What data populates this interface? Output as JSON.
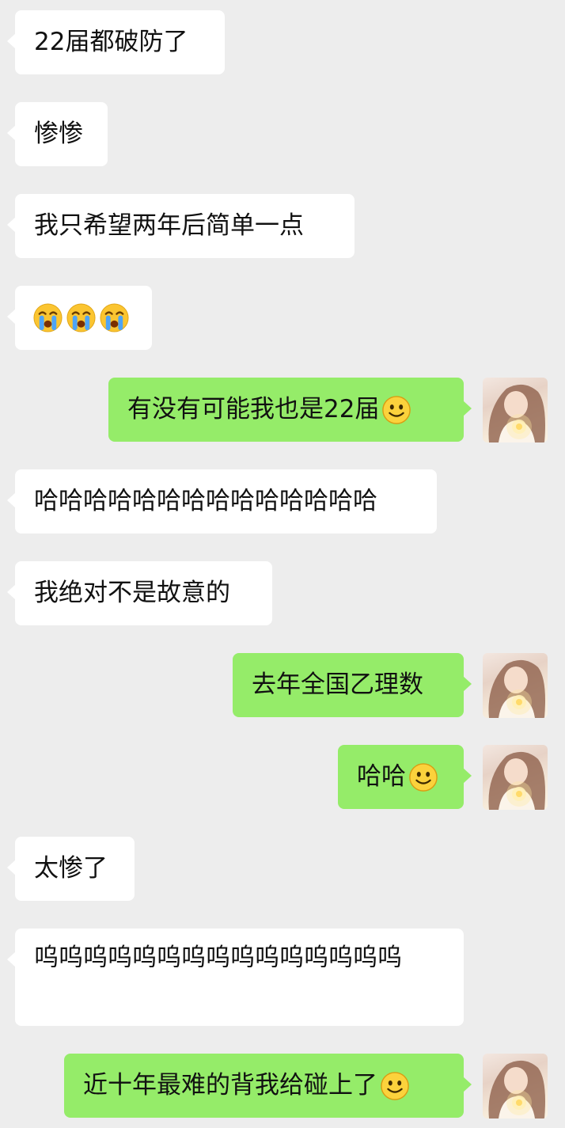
{
  "messages": [
    {
      "side": "left",
      "text": "22届都破防了"
    },
    {
      "side": "left",
      "text": "惨惨"
    },
    {
      "side": "left",
      "text": "我只希望两年后简单一点"
    },
    {
      "side": "left",
      "text": "",
      "emoji": [
        "loudly-crying-face",
        "loudly-crying-face",
        "loudly-crying-face"
      ]
    },
    {
      "side": "right",
      "text": "有没有可能我也是22届",
      "emoji": [
        "smiling-face"
      ]
    },
    {
      "side": "left",
      "text": "哈哈哈哈哈哈哈哈哈哈哈哈哈哈"
    },
    {
      "side": "left",
      "text": "我绝对不是故意的"
    },
    {
      "side": "right",
      "text": "去年全国乙理数"
    },
    {
      "side": "right",
      "text": "哈哈",
      "emoji": [
        "smiling-face"
      ]
    },
    {
      "side": "left",
      "text": "太惨了"
    },
    {
      "side": "left",
      "text": "呜呜呜呜呜呜呜呜呜呜呜呜呜呜呜"
    },
    {
      "side": "right",
      "text": "近十年最难的背我给碰上了",
      "emoji": [
        "smiling-face"
      ]
    }
  ],
  "colors": {
    "background": "#ededed",
    "incoming_bubble": "#ffffff",
    "outgoing_bubble": "#95ec69",
    "text": "#111111"
  },
  "icons": {
    "avatar": "user-avatar-girl-with-light",
    "cry": "loudly-crying-face-emoji",
    "smile": "smiling-face-emoji"
  }
}
